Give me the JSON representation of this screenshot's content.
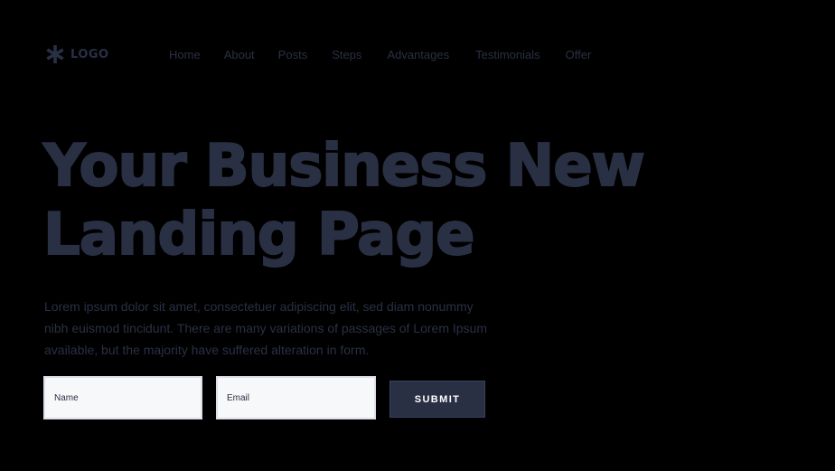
{
  "header": {
    "logo": {
      "icon": "asterisk-icon",
      "text": "LOGO"
    },
    "nav": [
      {
        "label": "Home"
      },
      {
        "label": "About"
      },
      {
        "label": "Posts"
      },
      {
        "label": "Steps"
      },
      {
        "label": "Advantages"
      },
      {
        "label": "Testimonials"
      },
      {
        "label": "Offer"
      }
    ]
  },
  "hero": {
    "title_line1": "Your Business New",
    "title_line2": "Landing Page",
    "text": "Lorem ipsum dolor sit amet, consectetuer adipiscing elit, sed diam nonummy nibh euismod tincidunt. There are many variations of passages of Lorem Ipsum available, but the majority have suffered alteration in form."
  },
  "form": {
    "name_placeholder": "Name",
    "email_placeholder": "Email",
    "submit_label": "SUBMIT"
  },
  "colors": {
    "background": "#000000",
    "primary": "#2a3044",
    "field_background": "#f7f8fa",
    "button_text": "#ffffff"
  }
}
